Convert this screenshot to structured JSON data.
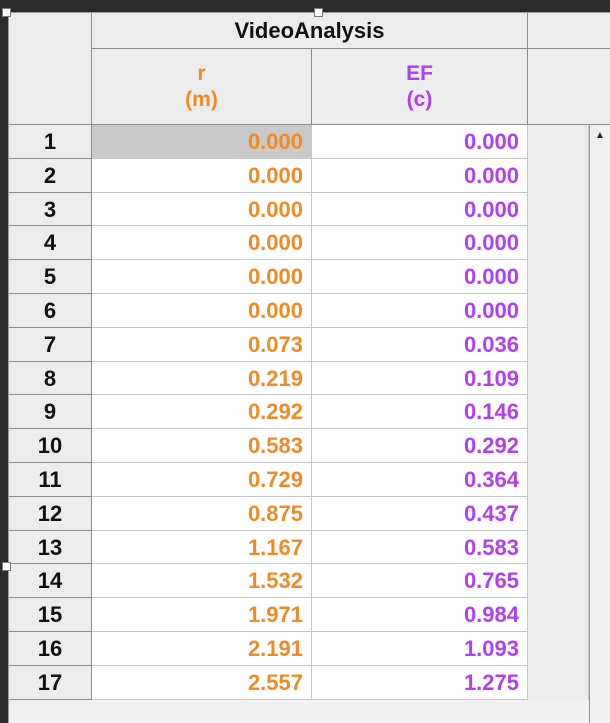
{
  "table": {
    "group_title": "VideoAnalysis",
    "columns": [
      {
        "name": "r",
        "unit": "(m)",
        "color": "#f08a24"
      },
      {
        "name": "EF",
        "unit": "(c)",
        "color": "#b13ef0"
      }
    ],
    "rows": [
      {
        "n": "1",
        "r": "0.000",
        "ef": "0.000"
      },
      {
        "n": "2",
        "r": "0.000",
        "ef": "0.000"
      },
      {
        "n": "3",
        "r": "0.000",
        "ef": "0.000"
      },
      {
        "n": "4",
        "r": "0.000",
        "ef": "0.000"
      },
      {
        "n": "5",
        "r": "0.000",
        "ef": "0.000"
      },
      {
        "n": "6",
        "r": "0.000",
        "ef": "0.000"
      },
      {
        "n": "7",
        "r": "0.073",
        "ef": "0.036"
      },
      {
        "n": "8",
        "r": "0.219",
        "ef": "0.109"
      },
      {
        "n": "9",
        "r": "0.292",
        "ef": "0.146"
      },
      {
        "n": "10",
        "r": "0.583",
        "ef": "0.292"
      },
      {
        "n": "11",
        "r": "0.729",
        "ef": "0.364"
      },
      {
        "n": "12",
        "r": "0.875",
        "ef": "0.437"
      },
      {
        "n": "13",
        "r": "1.167",
        "ef": "0.583"
      },
      {
        "n": "14",
        "r": "1.532",
        "ef": "0.765"
      },
      {
        "n": "15",
        "r": "1.971",
        "ef": "0.984"
      },
      {
        "n": "16",
        "r": "2.191",
        "ef": "1.093"
      },
      {
        "n": "17",
        "r": "2.557",
        "ef": "1.275"
      }
    ]
  },
  "scrollbar": {
    "up_icon": "scroll-up-arrow-icon"
  }
}
